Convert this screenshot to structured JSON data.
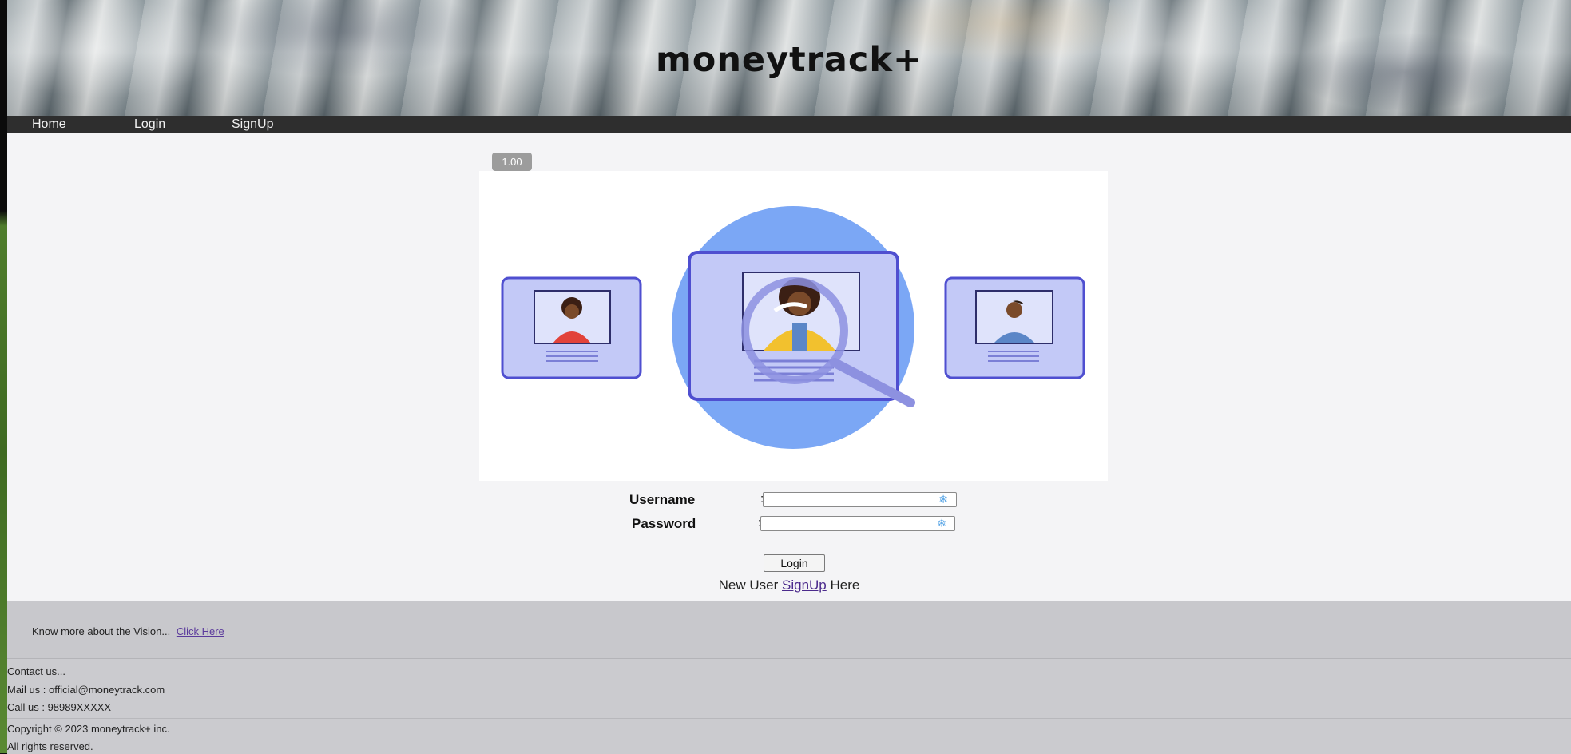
{
  "header": {
    "site_title": "moneytrack+"
  },
  "nav": {
    "items": [
      {
        "label": "Home"
      },
      {
        "label": "Login"
      },
      {
        "label": "SignUp"
      }
    ]
  },
  "zoom_badge": "1.00",
  "login_form": {
    "username_label": "Username",
    "password_label": "Password",
    "colon": ":",
    "username_value": "",
    "password_value": "",
    "login_button": "Login",
    "signup_prefix": "New User",
    "signup_link": "SignUp",
    "signup_suffix": "Here"
  },
  "vision": {
    "text": "Know more about the Vision...",
    "link": "Click Here"
  },
  "contact": {
    "heading": "Contact us...",
    "mail": "Mail us : official@moneytrack.com",
    "phone": "Call us : 98989XXXXX"
  },
  "footer": {
    "copyright": "Copyright © 2023 moneytrack+ inc.",
    "rights": "All rights reserved."
  },
  "colors": {
    "navbar": "#2e2e2e",
    "page_bg": "#f4f4f6",
    "footer_bg": "#cbcbcf",
    "illustration_circle": "#7ba7f5",
    "illustration_card": "#c3c9f7",
    "illustration_border": "#4f4fd0"
  }
}
